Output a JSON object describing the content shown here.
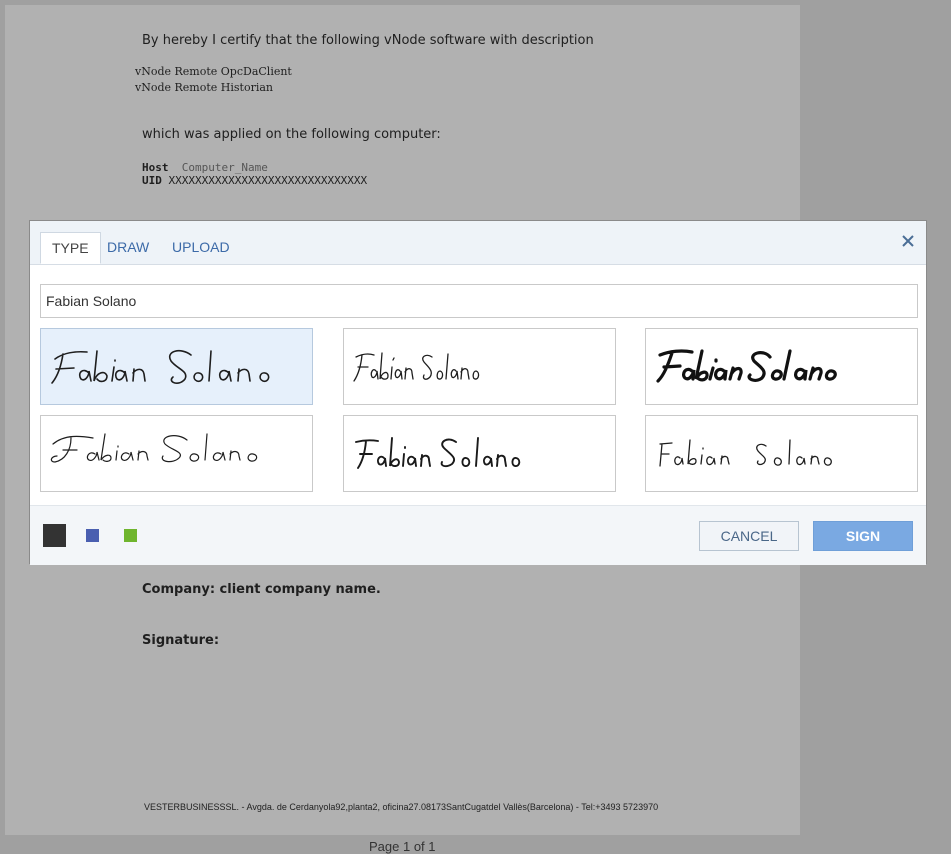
{
  "document": {
    "cert_line": "By hereby I certify that the following vNode software with description",
    "items": [
      "vNode Remote OpcDaClient",
      "vNode Remote Historian"
    ],
    "applied_line": "which was applied on the following computer:",
    "host_label": "Host",
    "host_value": "Computer_Name",
    "uid_label": "UID",
    "uid_value": "XXXXXXXXXXXXXXXXXXXXXXXXXXXXXX",
    "company_line": "Company: client company name.",
    "signature_label": "Signature:",
    "footer": "VESTERBUSINESSSL. - Avgda. de Cerdanyola92,planta2, oficina27.08173SantCugatdel Vallès(Barcelona) - Tel:+3493 5723970",
    "pager": "Page 1 of 1"
  },
  "dialog": {
    "tabs": [
      {
        "label": "TYPE",
        "active": true
      },
      {
        "label": "DRAW",
        "active": false
      },
      {
        "label": "UPLOAD",
        "active": false
      }
    ],
    "close_icon": "close-icon",
    "name_value": "Fabian Solano",
    "signatures": [
      {
        "style": "script-upright",
        "selected": true
      },
      {
        "style": "script-narrow",
        "selected": false
      },
      {
        "style": "script-bold-italic",
        "selected": false
      },
      {
        "style": "script-calligraphic",
        "selected": false
      },
      {
        "style": "script-hand",
        "selected": false
      },
      {
        "style": "script-thin-spaced",
        "selected": false
      }
    ],
    "colors": [
      "#333333",
      "#4a5fb0",
      "#6fb52e"
    ],
    "cancel_label": "CANCEL",
    "sign_label": "SIGN"
  }
}
